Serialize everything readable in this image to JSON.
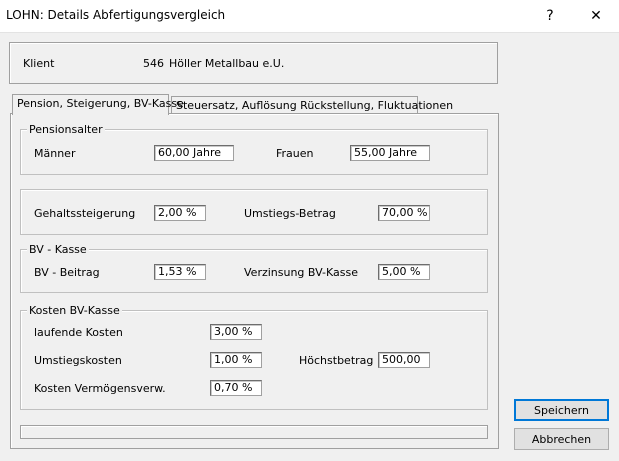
{
  "window": {
    "title": "LOHN: Details Abfertigungsvergleich",
    "help_glyph": "?",
    "close_glyph": "✕"
  },
  "client": {
    "label": "Klient",
    "number": "546",
    "name": "Höller Metallbau e.U."
  },
  "tabs": [
    {
      "label": "Pension, Steigerung, BV-Kasse",
      "active": true
    },
    {
      "label": "Steuersatz, Auflösung Rückstellung, Fluktuationen",
      "active": false
    }
  ],
  "pension": {
    "legend": "Pensionsalter",
    "men_label": "Männer",
    "men_value": "60,00  Jahre",
    "women_label": "Frauen",
    "women_value": "55,00  Jahre"
  },
  "increase": {
    "salary_label": "Gehaltssteigerung",
    "salary_value": "2,00  %",
    "switch_label": "Umstiegs-Betrag",
    "switch_value": "70,00  %"
  },
  "bvkasse": {
    "legend": "BV - Kasse",
    "contribution_label": "BV - Beitrag",
    "contribution_value": "1,53  %",
    "interest_label": "Verzinsung BV-Kasse",
    "interest_value": "5,00  %"
  },
  "costs": {
    "legend": "Kosten BV-Kasse",
    "running_label": "laufende Kosten",
    "running_value": "3,00  %",
    "switch_label": "Umstiegskosten",
    "switch_value": "1,00  %",
    "max_label": "Höchstbetrag",
    "max_value": "500,00",
    "asset_label": "Kosten Vermögensverw.",
    "asset_value": "0,70  %"
  },
  "buttons": {
    "save": "Speichern",
    "cancel": "Abbrechen"
  }
}
